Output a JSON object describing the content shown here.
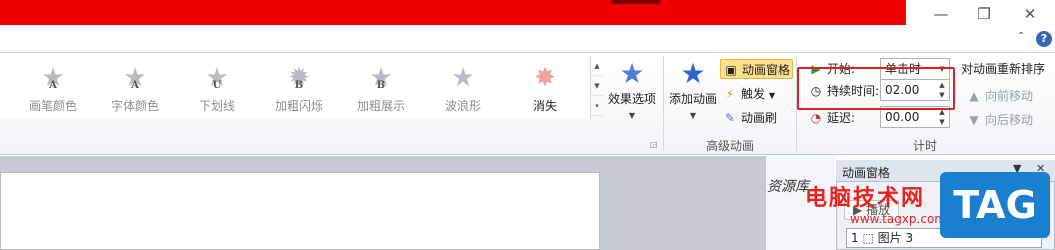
{
  "window": {
    "minimize_glyph": "—",
    "restore_glyph": "❐",
    "close_glyph": "✕",
    "help_glyph": "?",
    "collapse_glyph": "⌃"
  },
  "colors": {
    "title_band": "#ee0000",
    "highlight": "#fde18b",
    "annotation_box": "#e02020",
    "accent_blue": "#4f7fd1",
    "watermark_red": "#e8231f"
  },
  "effects_gallery": [
    {
      "label": "画笔颜色",
      "icon": "star-A-icon",
      "glyph": "A"
    },
    {
      "label": "字体颜色",
      "icon": "star-A-icon",
      "glyph": "A"
    },
    {
      "label": "下划线",
      "icon": "star-U-icon",
      "glyph": "U"
    },
    {
      "label": "加粗闪烁",
      "icon": "star-B-burst-icon",
      "glyph": "B"
    },
    {
      "label": "加粗展示",
      "icon": "star-B-icon",
      "glyph": "B"
    },
    {
      "label": "波浪形",
      "icon": "star-icon",
      "glyph": ""
    },
    {
      "label": "消失",
      "icon": "burst-icon",
      "glyph": ""
    }
  ],
  "effect_options": {
    "label": "效果选项"
  },
  "advanced_animation": {
    "add_animation": "添加动画",
    "animation_pane": "动画窗格",
    "trigger": "触发",
    "animation_painter": "动画刷",
    "group_label": "高级动画"
  },
  "timing": {
    "start_label": "开始:",
    "start_value": "单击时",
    "duration_label": "持续时间:",
    "duration_value": "02.00",
    "delay_label": "延迟:",
    "delay_value": "00.00",
    "group_label": "计时",
    "reorder_title": "对动画重新排序",
    "move_earlier": "向前移动",
    "move_later": "向后移动"
  },
  "resource_pane": {
    "title": "资源库"
  },
  "animation_pane": {
    "title": "动画窗格",
    "play": "播放",
    "item_index": "1",
    "item_label": "图片 3"
  },
  "watermark": {
    "site_name": "电脑技术网",
    "url": "www.tagxp.com",
    "logo": "TAG"
  }
}
